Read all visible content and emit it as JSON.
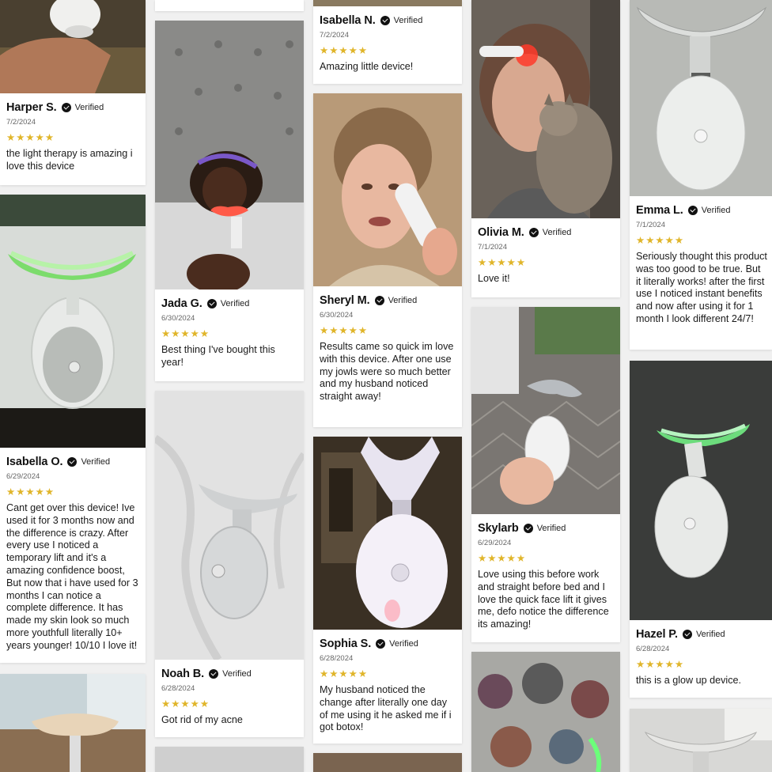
{
  "verified_label": "Verified",
  "colors": {
    "star": "#e0b52a",
    "background": "#f0f0f0",
    "card": "#ffffff"
  },
  "reviews": [
    {
      "name": "Harper S.",
      "date": "7/2/2024",
      "stars": "★★★★★",
      "rating": 5,
      "text": "the light therapy is amazing i love this device"
    },
    {
      "name": "Isabella O.",
      "date": "6/29/2024",
      "stars": "★★★★★",
      "rating": 5,
      "text": "Cant get over this device! Ive used it for 3 months now and the difference is crazy. After every use I noticed a temporary lift and it's a amazing confidence boost, But now that i have used for 3 months I can notice a complete difference. It has made my skin look so much more youthfull literally 10+ years younger! 10/10 I love it!"
    },
    {
      "name": "Jada G.",
      "date": "6/30/2024",
      "stars": "★★★★★",
      "rating": 5,
      "text": "Best thing I've bought this year!"
    },
    {
      "name": "Noah B.",
      "date": "6/28/2024",
      "stars": "★★★★★",
      "rating": 5,
      "text": "Got rid of my acne"
    },
    {
      "name": "Isabella N.",
      "date": "7/2/2024",
      "stars": "★★★★★",
      "rating": 5,
      "text": "Amazing little device!"
    },
    {
      "name": "Sheryl M.",
      "date": "6/30/2024",
      "stars": "★★★★★",
      "rating": 5,
      "text": "Results came so quick im love with this device. After one use my jowls were so much better and my husband noticed straight away!"
    },
    {
      "name": "Sophia S.",
      "date": "6/28/2024",
      "stars": "★★★★★",
      "rating": 5,
      "text": "My husband noticed the change after literally one day of me using it he asked me if i got botox!"
    },
    {
      "name": "Olivia M.",
      "date": "7/1/2024",
      "stars": "★★★★★",
      "rating": 5,
      "text": "Love it!"
    },
    {
      "name": "Skylarb",
      "date": "6/29/2024",
      "stars": "★★★★★",
      "rating": 5,
      "text": "Love using this before work and straight before bed and I love the quick face lift it gives me, defo notice the difference its amazing!"
    },
    {
      "name": "Emma L.",
      "date": "7/1/2024",
      "stars": "★★★★★",
      "rating": 5,
      "text": "Seriously thought this product was too good to be true. But it literally works! after the first use I noticed instant benefits and now after using it for 1 month I look different 24/7!"
    },
    {
      "name": "Hazel P.",
      "date": "6/28/2024",
      "stars": "★★★★★",
      "rating": 5,
      "text": "this is a glow up device."
    }
  ]
}
